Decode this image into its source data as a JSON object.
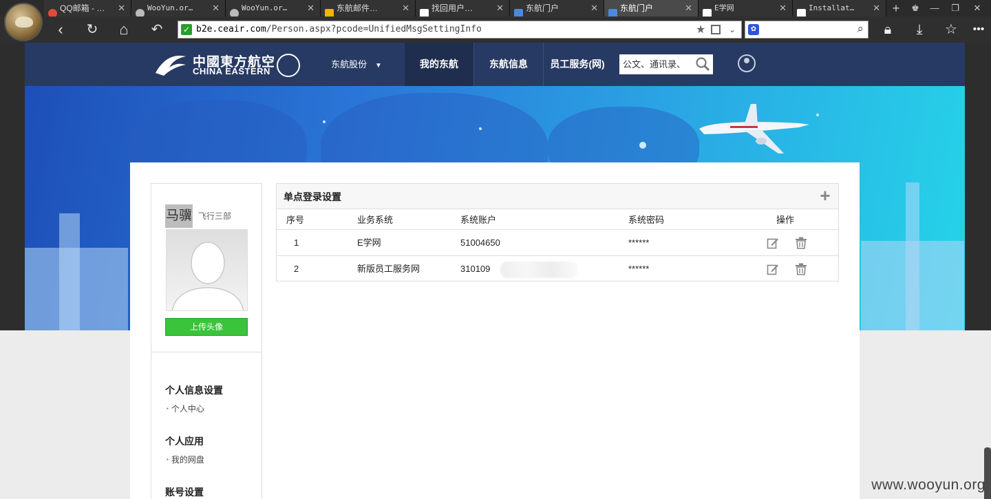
{
  "browser": {
    "tabs": [
      {
        "title": "QQ邮箱 - …",
        "icon_color": "#e04b3a"
      },
      {
        "title": "WooYun.or…",
        "icon_color": "#bbbbbb"
      },
      {
        "title": "WooYun.or…",
        "icon_color": "#bbbbbb"
      },
      {
        "title": "东航邮件…",
        "icon_color": "#f2b400"
      },
      {
        "title": "找回用户…",
        "icon_color": "#ffffff"
      },
      {
        "title": "东航门户",
        "icon_color": "#4a8ad8"
      },
      {
        "title": "东航门户",
        "icon_color": "#4a8ad8"
      },
      {
        "title": "E学网",
        "icon_color": "#ffffff"
      },
      {
        "title": "Installat…",
        "icon_color": "#ffffff"
      }
    ],
    "url_host": "b2e.ceair.com",
    "url_path": "/Person.aspx?pcode=UnifiedMsgSettingInfo"
  },
  "site": {
    "logo_cn": "中國東方航空",
    "logo_en": "CHINA EASTERN",
    "nav": [
      "东航股份",
      "我的东航",
      "东航信息",
      "员工服务(网)"
    ],
    "search_placeholder": "公文、通讯录、"
  },
  "sidebar": {
    "user_name": "马骥",
    "department": "飞行三部",
    "upload_label": "上传头像",
    "sections": [
      {
        "title": "个人信息设置",
        "links": [
          "个人中心"
        ]
      },
      {
        "title": "个人应用",
        "links": [
          "我的网盘"
        ]
      },
      {
        "title": "账号设置",
        "links": []
      }
    ]
  },
  "panel": {
    "title": "单点登录设置",
    "add_label": "+",
    "headers": [
      "序号",
      "业务系统",
      "系统账户",
      "系统密码",
      "操作"
    ],
    "rows": [
      {
        "index": "1",
        "system": "E学网",
        "account": "51004650",
        "password": "******"
      },
      {
        "index": "2",
        "system": "新版员工服务网",
        "account": "310109",
        "password": "******"
      }
    ]
  },
  "watermark": "www.wooyun.org",
  "colors": {
    "header_bg": "#273a63",
    "upload_btn": "#3bc33b",
    "banner_start": "#1d4fb7",
    "banner_end": "#26d4e8"
  }
}
